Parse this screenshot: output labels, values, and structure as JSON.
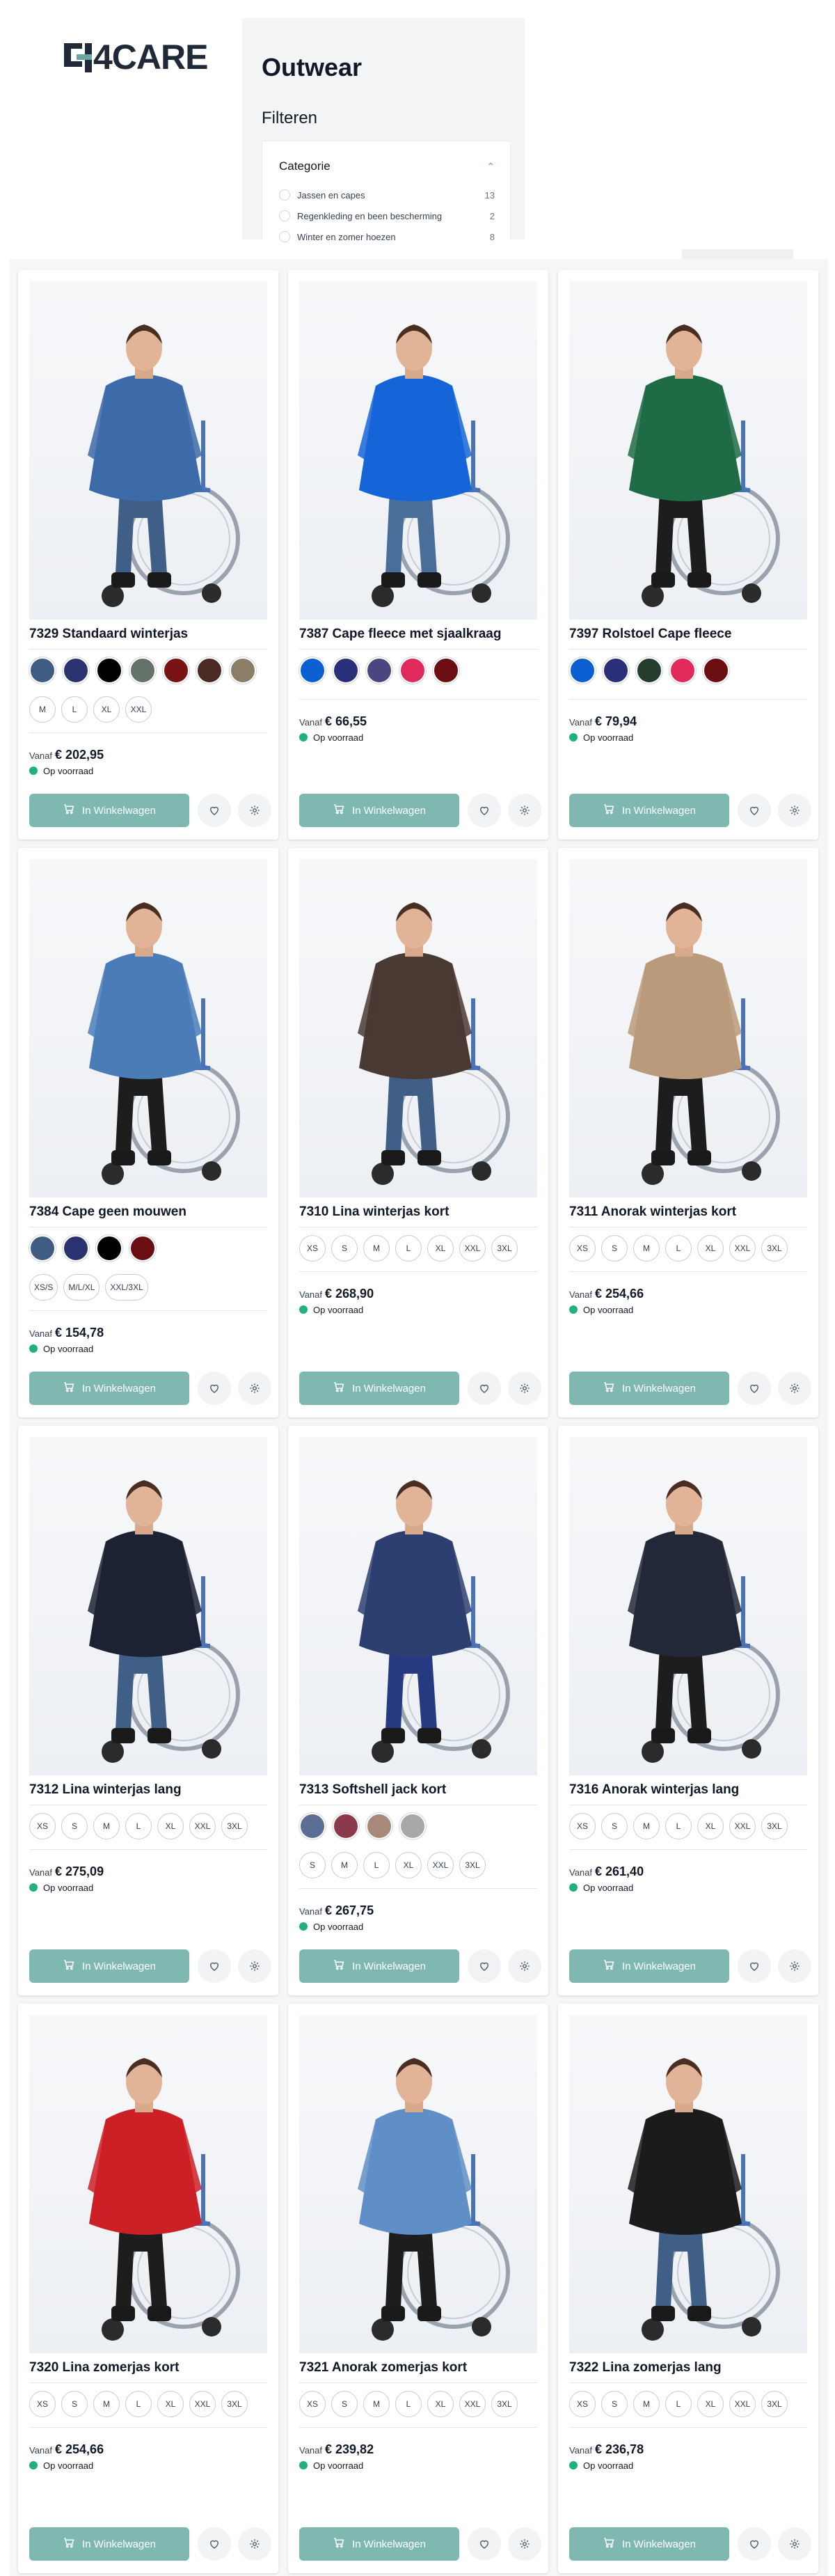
{
  "brand": {
    "logo_text": "4CARE"
  },
  "page": {
    "title": "Outwear",
    "filters_heading": "Filteren"
  },
  "filter": {
    "category_label": "Categorie",
    "options": [
      {
        "label": "Jassen en capes",
        "count": "13"
      },
      {
        "label": "Regenkleding en been bescherming",
        "count": "2"
      },
      {
        "label": "Winter en zomer hoezen",
        "count": "8"
      }
    ]
  },
  "common": {
    "from_label": "Vanaf",
    "stock_label": "Op voorraad",
    "cart_label": "In Winkelwagen"
  },
  "colors": {
    "accent": "#7fb8b1",
    "stock_dot": "#22b07d"
  },
  "products": [
    {
      "title": "7329 Standaard winterjas",
      "price": "€ 202,95",
      "garment": "#3d6aa8",
      "pants": "#3f5f86",
      "swatches": [
        "#3f5d82",
        "#2a3370",
        "#000000",
        "#64726a",
        "#7a1414",
        "#4a2a22",
        "#8a7e66"
      ],
      "sizes": [
        "M",
        "L",
        "XL",
        "XXL"
      ]
    },
    {
      "title": "7387 Cape fleece met sjaalkraag",
      "price": "€ 66,55",
      "garment": "#1565d8",
      "pants": "#4a6e9a",
      "swatches": [
        "#0b5fd1",
        "#2a2f7a",
        "#4a4680",
        "#e12a5c",
        "#6b0e12"
      ],
      "sizes": []
    },
    {
      "title": "7397 Rolstoel Cape fleece",
      "price": "€ 79,94",
      "garment": "#1e6b45",
      "pants": "#1d1d1d",
      "swatches": [
        "#0b5fd1",
        "#2a2f7a",
        "#243d2c",
        "#e12a5c",
        "#6b0e12"
      ],
      "sizes": []
    },
    {
      "title": "7384 Cape geen mouwen",
      "price": "€ 154,78",
      "garment": "#4a7cb8",
      "pants": "#1d1d1d",
      "swatches": [
        "#3f5d82",
        "#2a3370",
        "#000000",
        "#6b0e12"
      ],
      "sizes": [
        "XS/S",
        "M/L/XL",
        "XXL/3XL"
      ]
    },
    {
      "title": "7310 Lina winterjas kort",
      "price": "€ 268,90",
      "garment": "#4a3a34",
      "pants": "#3f5f86",
      "swatches": [],
      "sizes": [
        "XS",
        "S",
        "M",
        "L",
        "XL",
        "XXL",
        "3XL"
      ]
    },
    {
      "title": "7311 Anorak winterjas kort",
      "price": "€ 254,66",
      "garment": "#b99a7a",
      "pants": "#1d1d1d",
      "swatches": [],
      "sizes": [
        "XS",
        "S",
        "M",
        "L",
        "XL",
        "XXL",
        "3XL"
      ]
    },
    {
      "title": "7312 Lina winterjas lang",
      "price": "€ 275,09",
      "garment": "#1c2233",
      "pants": "#3f5f86",
      "swatches": [],
      "sizes": [
        "XS",
        "S",
        "M",
        "L",
        "XL",
        "XXL",
        "3XL"
      ]
    },
    {
      "title": "7313 Softshell jack kort",
      "price": "€ 267,75",
      "garment": "#2d3f70",
      "pants": "#263a82",
      "swatches": [
        "#5a6e96",
        "#8a3a4a",
        "#a98a7a",
        "#a8a8a8"
      ],
      "sizes": [
        "S",
        "M",
        "L",
        "XL",
        "XXL",
        "3XL"
      ]
    },
    {
      "title": "7316 Anorak winterjas lang",
      "price": "€ 261,40",
      "garment": "#232838",
      "pants": "#1d1d1d",
      "swatches": [],
      "sizes": [
        "XS",
        "S",
        "M",
        "L",
        "XL",
        "XXL",
        "3XL"
      ]
    },
    {
      "title": "7320 Lina zomerjas kort",
      "price": "€ 254,66",
      "garment": "#cc2027",
      "pants": "#1d1d1d",
      "swatches": [],
      "sizes": [
        "XS",
        "S",
        "M",
        "L",
        "XL",
        "XXL",
        "3XL"
      ]
    },
    {
      "title": "7321 Anorak zomerjas kort",
      "price": "€ 239,82",
      "garment": "#5f8fc6",
      "pants": "#1d1d1d",
      "swatches": [],
      "sizes": [
        "XS",
        "S",
        "M",
        "L",
        "XL",
        "XXL",
        "3XL"
      ]
    },
    {
      "title": "7322 Lina zomerjas lang",
      "price": "€ 236,78",
      "garment": "#1b1b1b",
      "pants": "#3f5f86",
      "swatches": [],
      "sizes": [
        "XS",
        "S",
        "M",
        "L",
        "XL",
        "XXL",
        "3XL"
      ]
    }
  ]
}
